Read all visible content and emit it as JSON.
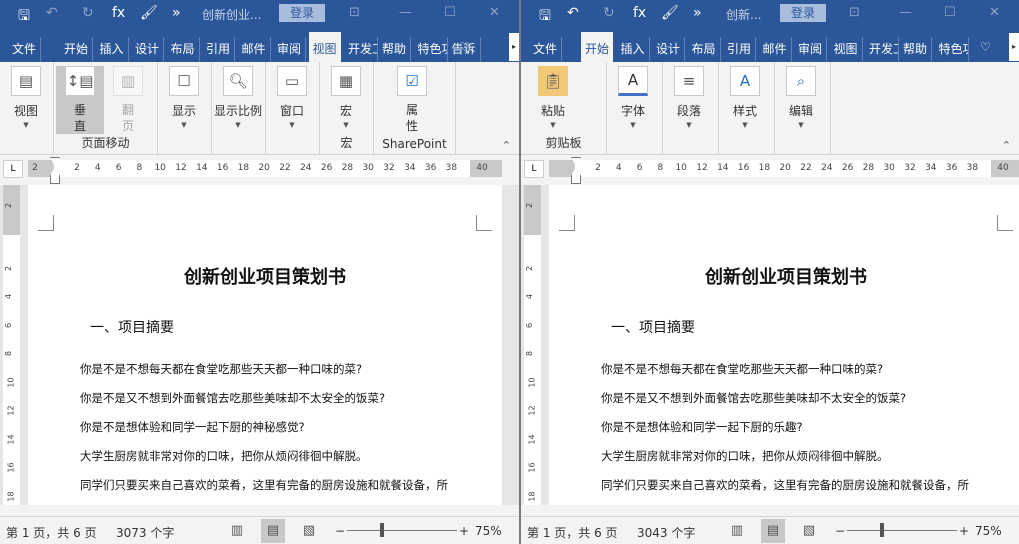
{
  "colors": {
    "brand": "#2b579a",
    "ribbon": "#f3f3f3",
    "active_view": "#c8c8c8"
  },
  "windows": [
    {
      "doc_title": "创新创业...",
      "login": "登录",
      "active_tab": "视图",
      "tabs": [
        "文件",
        "开始",
        "插入",
        "设计",
        "布局",
        "引用",
        "邮件",
        "审阅",
        "视图",
        "开发工",
        "帮助",
        "特色功",
        "告诉"
      ],
      "ribbon_groups": [
        {
          "buttons": [
            {
              "label": "视图",
              "icon": "page-icon",
              "caret": true
            }
          ],
          "label": ""
        },
        {
          "buttons": [
            {
              "label": "垂直",
              "icon": "vertical-scroll-icon",
              "active": true
            },
            {
              "label": "翻页",
              "icon": "side-to-side-icon",
              "disabled": true
            }
          ],
          "label": "页面移动"
        },
        {
          "buttons": [
            {
              "label": "显示",
              "icon": "show-icon",
              "caret": true
            }
          ],
          "label": ""
        },
        {
          "buttons": [
            {
              "label": "显示比例",
              "icon": "zoom-icon",
              "caret": true
            }
          ],
          "label": ""
        },
        {
          "buttons": [
            {
              "label": "窗口",
              "icon": "window-icon",
              "caret": true
            }
          ],
          "label": ""
        },
        {
          "buttons": [
            {
              "label": "宏",
              "icon": "macro-icon",
              "caret": true
            }
          ],
          "label": "宏"
        },
        {
          "buttons": [
            {
              "label": "属性",
              "icon": "sharepoint-icon"
            }
          ],
          "label": "SharePoint"
        }
      ],
      "ruler_left": "2",
      "ruler_ticks": [
        "2",
        "4",
        "6",
        "8",
        "10",
        "12",
        "14",
        "16",
        "18",
        "20",
        "22",
        "24",
        "26",
        "28",
        "30",
        "32",
        "34",
        "36",
        "38"
      ],
      "ruler_right": "40",
      "vruler_ticks": [
        "2",
        "2",
        "4",
        "6",
        "8",
        "10",
        "12",
        "14",
        "16",
        "18"
      ],
      "document": {
        "title": "创新创业项目策划书",
        "heading": "一、项目摘要",
        "paragraphs": [
          "你是不是不想每天都在食堂吃那些天天都一种口味的菜?",
          "你是不是又不想到外面餐馆去吃那些美味却不太安全的饭菜?",
          "你是不是想体验和同学一起下厨的神秘感觉?",
          "大学生厨房就非常对你的口味，把你从烦闷徘徊中解脱。",
          "同学们只要买来自己喜欢的菜肴，这里有完备的厨房设施和就餐设备，所"
        ]
      },
      "status": {
        "page": "第 1 页，共 6 页",
        "words": "3073 个字",
        "zoom": "75%",
        "zoom_fraction": 0.3
      }
    },
    {
      "doc_title": "创新...",
      "login": "登录",
      "active_tab": "开始",
      "tabs": [
        "文件",
        "开始",
        "插入",
        "设计",
        "布局",
        "引用",
        "邮件",
        "审阅",
        "视图",
        "开发工",
        "帮助",
        "特色功"
      ],
      "ribbon_groups": [
        {
          "buttons": [
            {
              "label": "粘贴",
              "icon": "paste-icon",
              "caret": true
            }
          ],
          "label": "剪贴板"
        },
        {
          "buttons": [
            {
              "label": "字体",
              "icon": "font-icon",
              "caret": true
            }
          ],
          "label": ""
        },
        {
          "buttons": [
            {
              "label": "段落",
              "icon": "paragraph-icon",
              "caret": true
            }
          ],
          "label": ""
        },
        {
          "buttons": [
            {
              "label": "样式",
              "icon": "styles-icon",
              "caret": true
            }
          ],
          "label": ""
        },
        {
          "buttons": [
            {
              "label": "编辑",
              "icon": "find-icon",
              "caret": true
            }
          ],
          "label": ""
        }
      ],
      "ruler_left": "",
      "ruler_ticks": [
        "2",
        "4",
        "6",
        "8",
        "10",
        "12",
        "14",
        "16",
        "18",
        "20",
        "22",
        "24",
        "26",
        "28",
        "30",
        "32",
        "34",
        "36",
        "38"
      ],
      "ruler_right": "40",
      "vruler_ticks": [
        "2",
        "2",
        "4",
        "6",
        "8",
        "10",
        "12",
        "14",
        "16",
        "18"
      ],
      "document": {
        "title": "创新创业项目策划书",
        "heading": "一、项目摘要",
        "paragraphs": [
          "你是不是不想每天都在食堂吃那些天天都一种口味的菜?",
          "你是不是又不想到外面餐馆去吃那些美味却不太安全的饭菜?",
          "你是不是想体验和同学一起下厨的乐趣?",
          "大学生厨房就非常对你的口味，把你从烦闷徘徊中解脱。",
          "同学们只要买来自己喜欢的菜肴，这里有完备的厨房设施和就餐设备，所"
        ]
      },
      "status": {
        "page": "第 1 页，共 6 页",
        "words": "3043 个字",
        "zoom": "75%",
        "zoom_fraction": 0.3
      }
    }
  ]
}
